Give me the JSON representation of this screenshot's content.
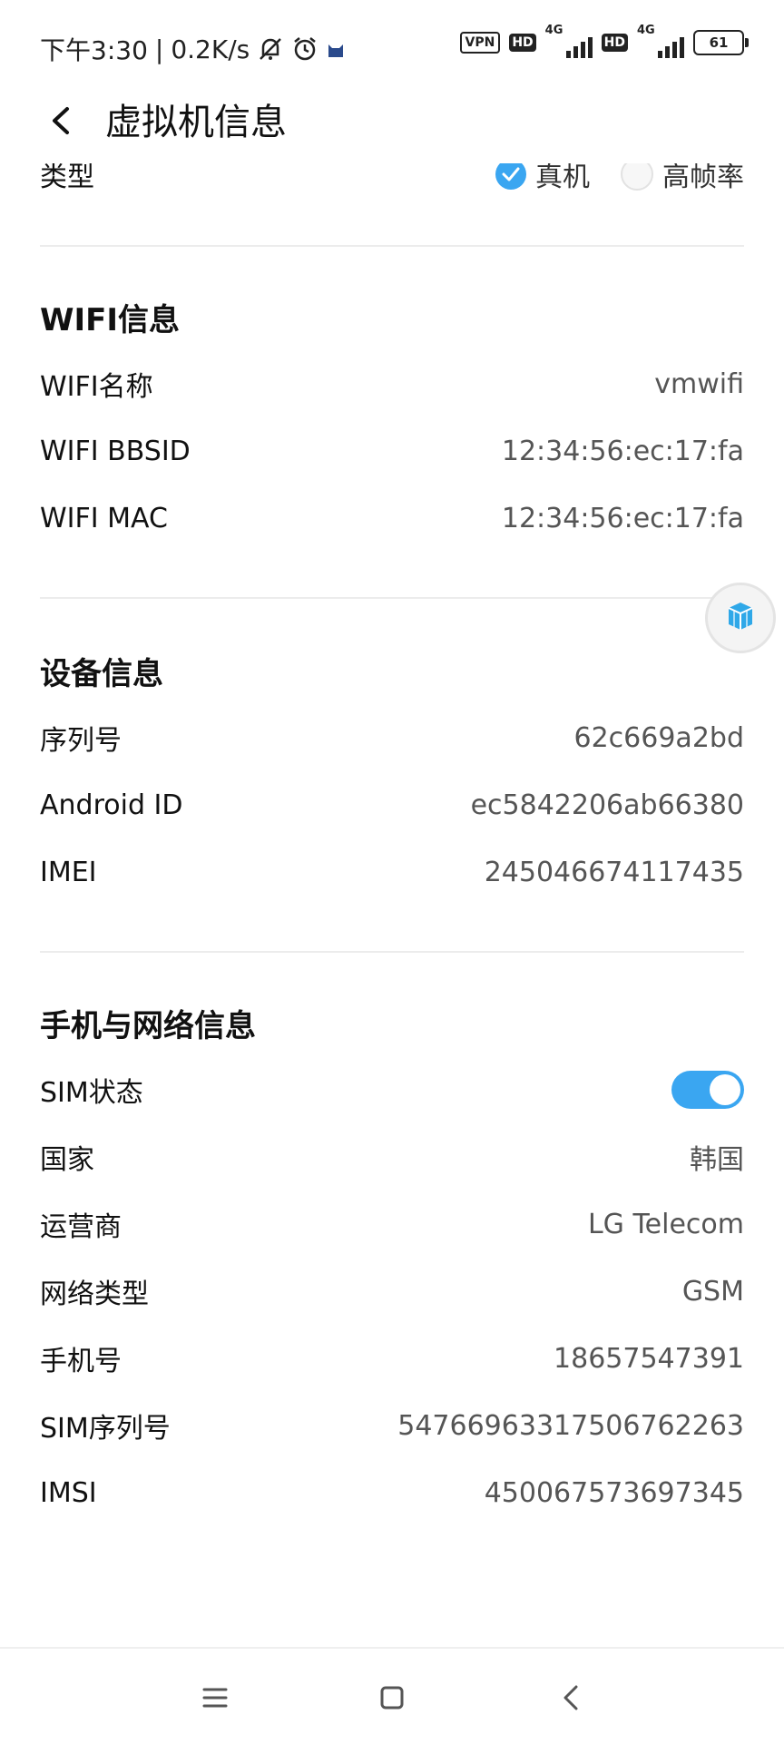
{
  "status_bar": {
    "time": "下午3:30",
    "speed": "0.2K/s",
    "separator": "|",
    "vpn": "VPN",
    "hd": "HD",
    "network": "4G",
    "battery": "61"
  },
  "header": {
    "title": "虚拟机信息"
  },
  "type_row": {
    "label": "类型",
    "option_real": "真机",
    "option_high_fps": "高帧率"
  },
  "wifi": {
    "title": "WIFI信息",
    "rows": [
      {
        "label": "WIFI名称",
        "value": "vmwifi"
      },
      {
        "label": "WIFI BBSID",
        "value": "12:34:56:ec:17:fa"
      },
      {
        "label": "WIFI MAC",
        "value": "12:34:56:ec:17:fa"
      }
    ]
  },
  "device": {
    "title": "设备信息",
    "rows": [
      {
        "label": "序列号",
        "value": "62c669a2bd"
      },
      {
        "label": "Android ID",
        "value": "ec5842206ab66380"
      },
      {
        "label": "IMEI",
        "value": "245046674117435"
      }
    ]
  },
  "phone": {
    "title": "手机与网络信息",
    "sim_status_label": "SIM状态",
    "rows": [
      {
        "label": "国家",
        "value": "韩国"
      },
      {
        "label": "运营商",
        "value": "LG Telecom"
      },
      {
        "label": "网络类型",
        "value": "GSM"
      },
      {
        "label": "手机号",
        "value": "18657547391"
      },
      {
        "label": "SIM序列号",
        "value": "54766963317506762263"
      },
      {
        "label": "IMSI",
        "value": "450067573697345"
      }
    ]
  },
  "colors": {
    "accent": "#3aa6f1"
  },
  "icons": {
    "back": "back-arrow-icon",
    "float": "cube-icon",
    "nav": [
      "menu-icon",
      "home-icon",
      "back-nav-icon"
    ]
  }
}
